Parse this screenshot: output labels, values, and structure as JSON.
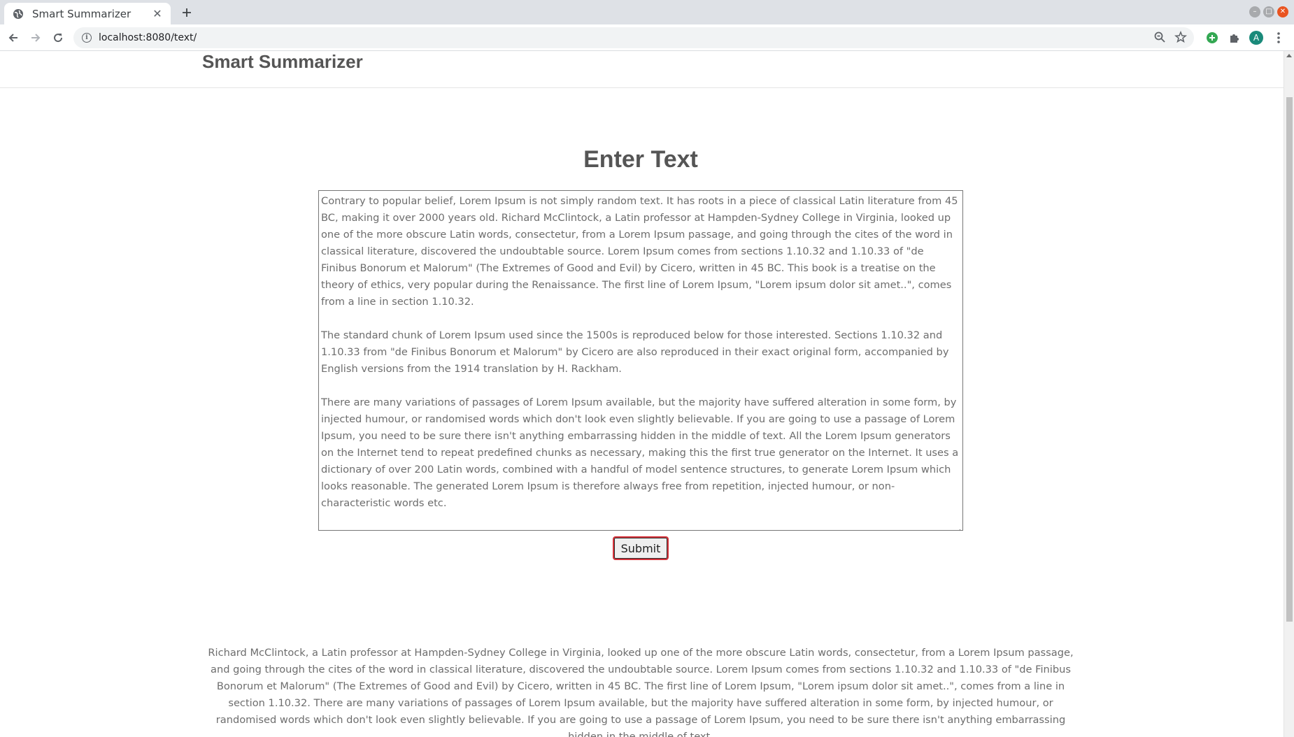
{
  "browser": {
    "tab_title": "Smart Summarizer",
    "url": "localhost:8080/text/",
    "avatar_letter": "A"
  },
  "page": {
    "brand": "Smart Summarizer",
    "heading": "Enter Text",
    "textarea_paragraphs": [
      "Contrary to popular belief, Lorem Ipsum is not simply random text. It has roots in a piece of classical Latin literature from 45 BC, making it over 2000 years old. Richard McClintock, a Latin professor at Hampden-Sydney College in Virginia, looked up one of the more obscure Latin words, consectetur, from a Lorem Ipsum passage, and going through the cites of the word in classical literature, discovered the undoubtable source. Lorem Ipsum comes from sections 1.10.32 and 1.10.33 of \"de Finibus Bonorum et Malorum\" (The Extremes of Good and Evil) by Cicero, written in 45 BC. This book is a treatise on the theory of ethics, very popular during the Renaissance. The first line of Lorem Ipsum, \"Lorem ipsum dolor sit amet..\", comes from a line in section 1.10.32.",
      "The standard chunk of Lorem Ipsum used since the 1500s is reproduced below for those interested. Sections 1.10.32 and 1.10.33 from \"de Finibus Bonorum et Malorum\" by Cicero are also reproduced in their exact original form, accompanied by English versions from the 1914 translation by H. Rackham.",
      "There are many variations of passages of Lorem Ipsum available, but the majority have suffered alteration in some form, by injected humour, or randomised words which don't look even slightly believable. If you are going to use a passage of Lorem Ipsum, you need to be sure there isn't anything embarrassing hidden in the middle of text. All the Lorem Ipsum generators on the Internet tend to repeat predefined chunks as necessary, making this the first true generator on the Internet. It uses a dictionary of over 200 Latin words, combined with a handful of model sentence structures, to generate Lorem Ipsum which looks reasonable. The generated Lorem Ipsum is therefore always free from repetition, injected humour, or non-characteristic words etc."
    ],
    "submit_label": "Submit",
    "summary": "Richard McClintock, a Latin professor at Hampden-Sydney College in Virginia, looked up one of the more obscure Latin words, consectetur, from a Lorem Ipsum passage, and going through the cites of the word in classical literature, discovered the undoubtable source. Lorem Ipsum comes from sections 1.10.32 and 1.10.33 of \"de Finibus Bonorum et Malorum\" (The Extremes of Good and Evil) by Cicero, written in 45 BC. The first line of Lorem Ipsum, \"Lorem ipsum dolor sit amet..\", comes from a line in section 1.10.32. There are many variations of passages of Lorem Ipsum available, but the majority have suffered alteration in some form, by injected humour, or randomised words which don't look even slightly believable. If you are going to use a passage of Lorem Ipsum, you need to be sure there isn't anything embarrassing hidden in the middle of text."
  },
  "icons": {
    "favicon": "globe-icon",
    "tab_close": "close-icon",
    "new_tab": "plus-icon",
    "back": "back-arrow-icon",
    "forward": "forward-arrow-icon",
    "reload": "reload-icon",
    "site_info": "info-icon",
    "zoom": "zoom-icon",
    "bookmark": "star-icon",
    "extension_add": "add-extension-icon",
    "extensions": "puzzle-icon",
    "menu": "kebab-menu-icon"
  },
  "colors": {
    "accent_focus": "#d6323a",
    "window_close": "#e95420",
    "heading_text": "#555555",
    "body_text": "#6d6d6d"
  }
}
